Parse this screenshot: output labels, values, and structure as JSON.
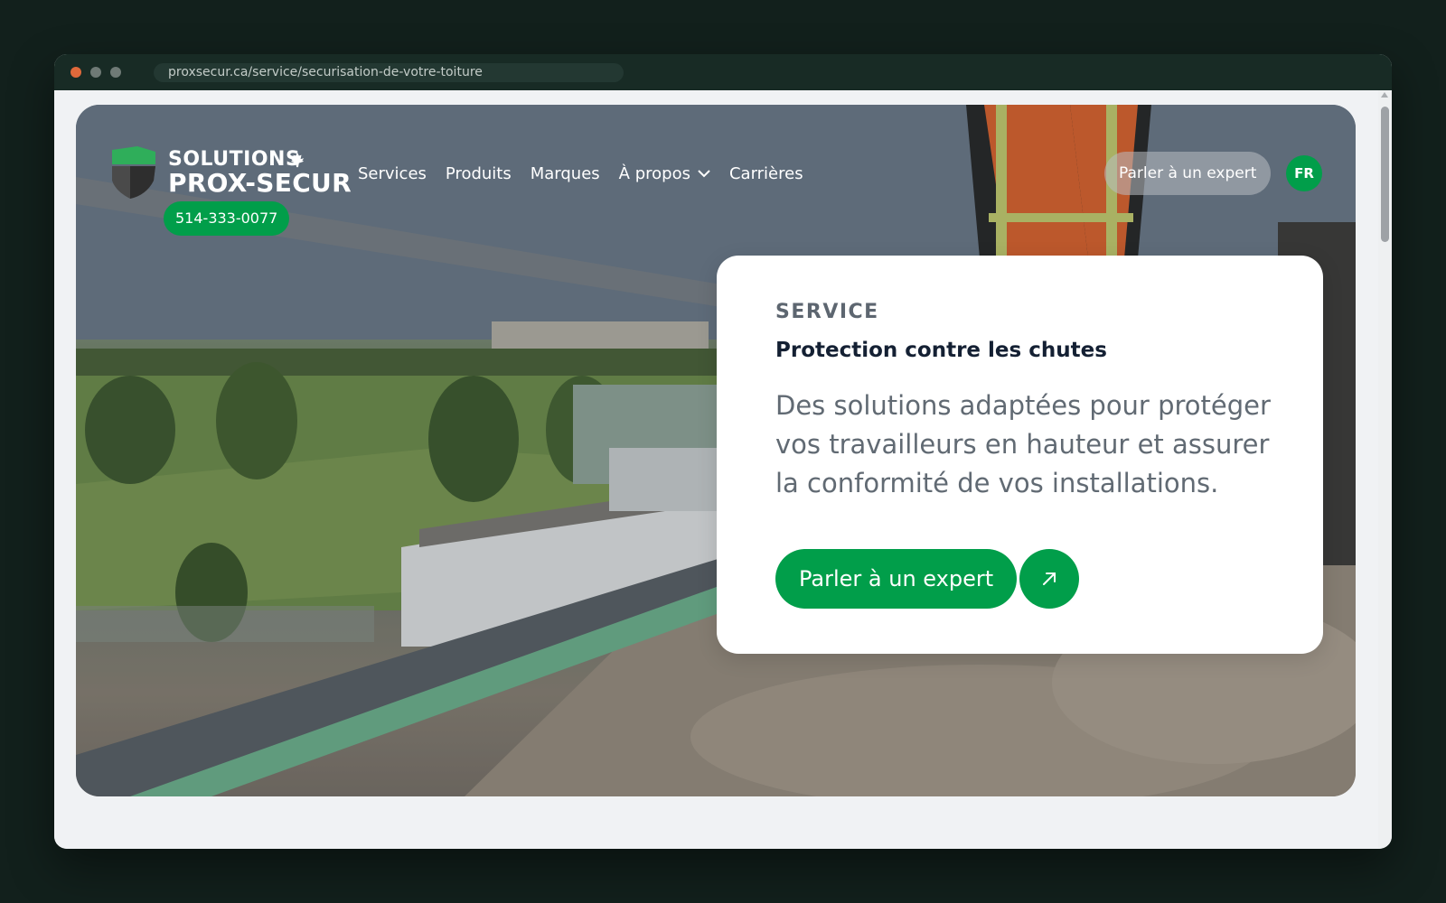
{
  "browser": {
    "url": "proxsecur.ca/service/securisation-de-votre-toiture"
  },
  "header": {
    "logo_line1": "SOLUTIONS",
    "logo_line2": "PROX-SECUR",
    "phone": "514-333-0077",
    "nav": [
      {
        "label": "Services"
      },
      {
        "label": "Produits"
      },
      {
        "label": "Marques"
      },
      {
        "label": "À propos"
      },
      {
        "label": "Carrières"
      }
    ],
    "cta_label": "Parler à un expert",
    "language": "FR"
  },
  "hero_card": {
    "eyebrow": "SERVICE",
    "title": "Protection contre les chutes",
    "description": "Des solutions adaptées pour protéger vos travailleurs en hauteur et assurer la conformité de vos installations.",
    "cta_label": "Parler à un expert"
  },
  "colors": {
    "brand_green": "#019e4a",
    "window_bg": "#12201c",
    "titlebar": "#182b25"
  }
}
